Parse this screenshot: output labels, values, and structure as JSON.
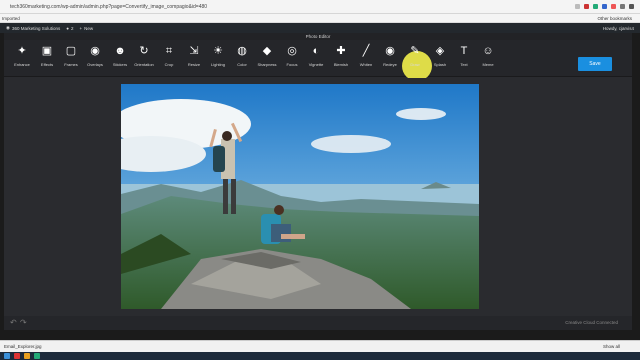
{
  "browser": {
    "url": "tech360marketing.com/wp-admin/admin.php?page=Convertify_image_compagio&id=480",
    "bookmark_label": "Imported",
    "other_bookmarks": "Other bookmarks"
  },
  "wpbar": {
    "site": "360 Marketing Solutions",
    "comments": "2",
    "new_label": "New",
    "howdy": "Howdy, cjarvis4"
  },
  "editor": {
    "title": "Photo Editor",
    "save_label": "Save",
    "cloud_status": "Creative Cloud Connected",
    "tools": [
      {
        "label": "Enhance",
        "icon": "wand-icon"
      },
      {
        "label": "Effects",
        "icon": "effects-icon"
      },
      {
        "label": "Frames",
        "icon": "frames-icon"
      },
      {
        "label": "Overlays",
        "icon": "overlays-icon"
      },
      {
        "label": "Stickers",
        "icon": "stickers-icon"
      },
      {
        "label": "Orientation",
        "icon": "orientation-icon"
      },
      {
        "label": "Crop",
        "icon": "crop-icon"
      },
      {
        "label": "Resize",
        "icon": "resize-icon"
      },
      {
        "label": "Lighting",
        "icon": "lighting-icon"
      },
      {
        "label": "Color",
        "icon": "color-icon"
      },
      {
        "label": "Sharpness",
        "icon": "sharpness-icon"
      },
      {
        "label": "Focus",
        "icon": "focus-icon"
      },
      {
        "label": "Vignette",
        "icon": "vignette-icon"
      },
      {
        "label": "Blemish",
        "icon": "blemish-icon"
      },
      {
        "label": "Whiten",
        "icon": "whiten-icon"
      },
      {
        "label": "Redeye",
        "icon": "redeye-icon"
      },
      {
        "label": "Draw",
        "icon": "draw-icon"
      },
      {
        "label": "Splash",
        "icon": "splash-icon"
      },
      {
        "label": "Text",
        "icon": "text-icon"
      },
      {
        "label": "Meme",
        "icon": "meme-icon"
      }
    ]
  },
  "downloads": {
    "file": "Email_Explorer.jpg",
    "show_all": "Show all"
  },
  "colors": {
    "accent": "#1a8fe0",
    "highlight": "#e8e64a"
  }
}
